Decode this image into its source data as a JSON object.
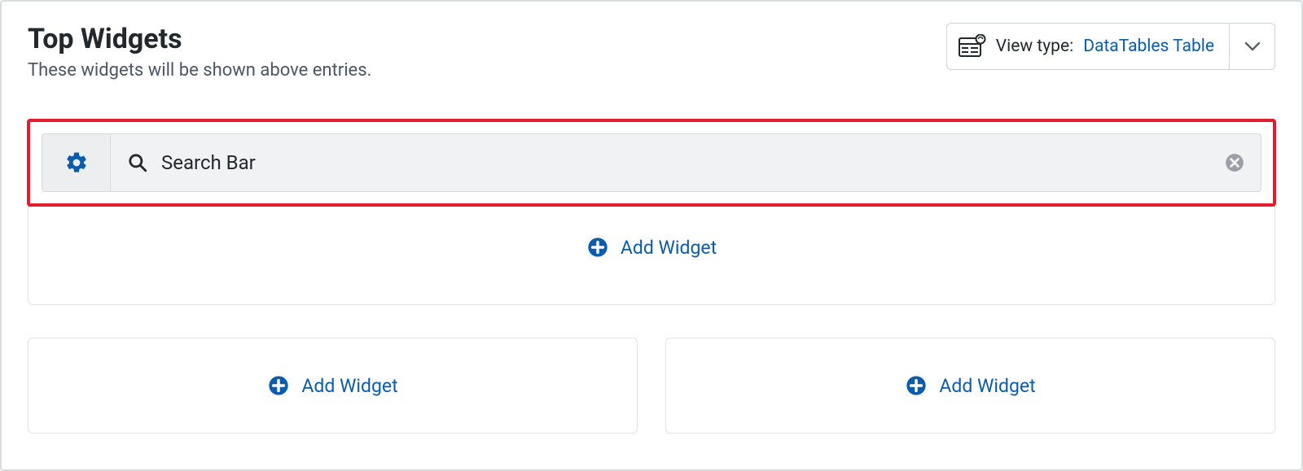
{
  "header": {
    "title": "Top Widgets",
    "subtitle": "These widgets will be shown above entries."
  },
  "view_type": {
    "label": "View type:",
    "value": "DataTables Table"
  },
  "widget": {
    "name": "Search Bar"
  },
  "actions": {
    "add_widget": "Add Widget"
  }
}
